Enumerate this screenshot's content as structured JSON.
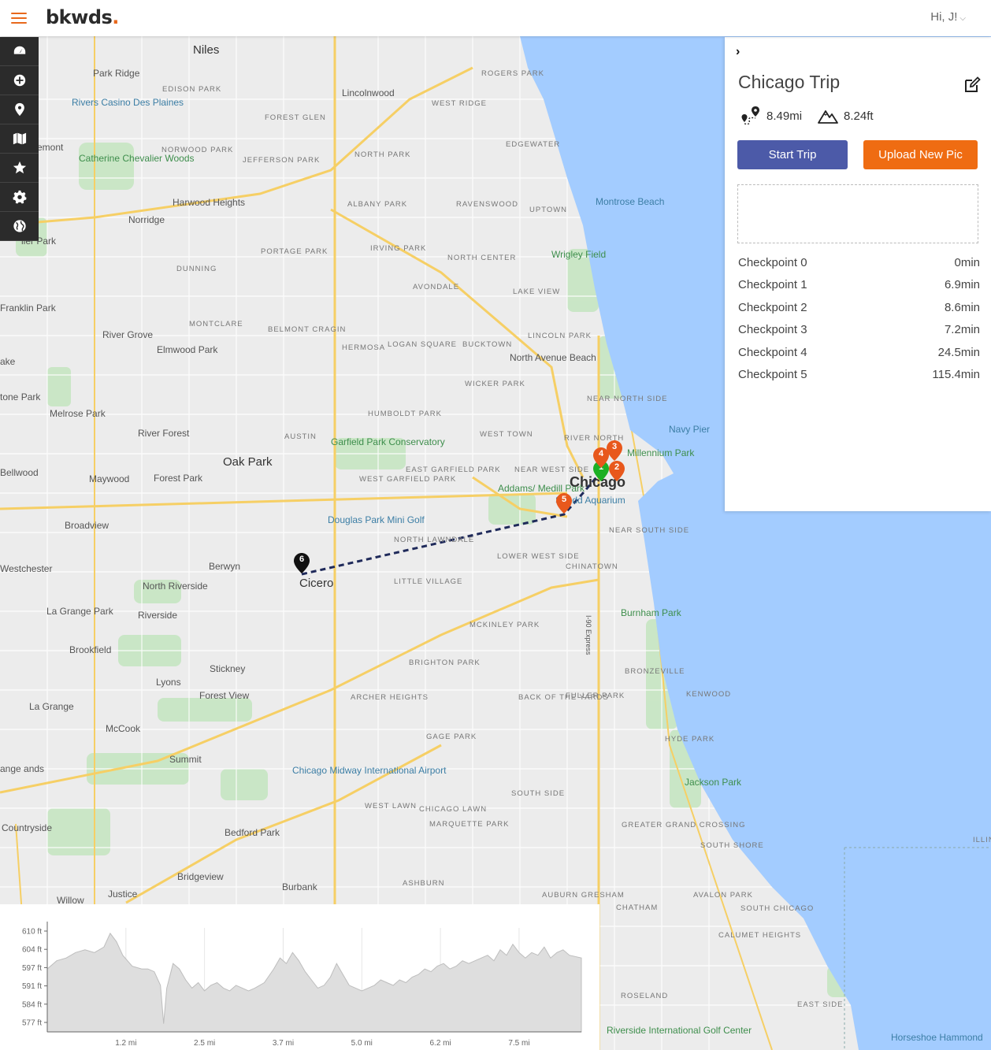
{
  "header": {
    "logo_text": "bkwds",
    "logo_dot": ".",
    "user_greeting": "Hi, J!",
    "user_chevron": "⌵"
  },
  "rail": {
    "items": [
      "dashboard-icon",
      "plus-circle-icon",
      "map-pin-icon",
      "map-icon",
      "star-icon",
      "cog-icon",
      "globe-icon"
    ]
  },
  "colors": {
    "accent": "#ef6c12",
    "primary_button": "#4c5aa8",
    "rail_bg": "#2b2b2b",
    "water": "#a3ccff",
    "start_marker": "#1db024",
    "checkpoint_marker": "#e8581c",
    "end_marker": "#111111",
    "route_line": "#1f2a5a"
  },
  "panel": {
    "collapse_glyph": "›",
    "title": "Chicago Trip",
    "distance": "8.49mi",
    "elevation": "8.24ft",
    "start_button": "Start Trip",
    "upload_button": "Upload New Pic",
    "checkpoints": [
      {
        "name": "Checkpoint 0",
        "time": "0min"
      },
      {
        "name": "Checkpoint 1",
        "time": "6.9min"
      },
      {
        "name": "Checkpoint 2",
        "time": "8.6min"
      },
      {
        "name": "Checkpoint 3",
        "time": "7.2min"
      },
      {
        "name": "Checkpoint 4",
        "time": "24.5min"
      },
      {
        "name": "Checkpoint 5",
        "time": "115.4min"
      }
    ]
  },
  "map": {
    "labels": [
      {
        "t": "Niles",
        "c": "big"
      },
      {
        "t": "Park Ridge",
        "c": ""
      },
      {
        "t": "Lincolnwood",
        "c": ""
      },
      {
        "t": "Rivers Casino Des Plaines",
        "c": "poi"
      },
      {
        "t": "EDISON PARK",
        "c": "small"
      },
      {
        "t": "ROGERS PARK",
        "c": "small"
      },
      {
        "t": "WEST RIDGE",
        "c": "small"
      },
      {
        "t": "FOREST GLEN",
        "c": "small"
      },
      {
        "t": "EDGEWATER",
        "c": "small"
      },
      {
        "t": "NORTH PARK",
        "c": "small"
      },
      {
        "t": "NORWOOD PARK",
        "c": "small"
      },
      {
        "t": "JEFFERSON PARK",
        "c": "small"
      },
      {
        "t": "Catherine Chevalier Woods",
        "c": "park"
      },
      {
        "t": "ALBANY PARK",
        "c": "small"
      },
      {
        "t": "RAVENSWOOD",
        "c": "small"
      },
      {
        "t": "UPTOWN",
        "c": "small"
      },
      {
        "t": "Montrose Beach",
        "c": "poi"
      },
      {
        "t": "Harwood Heights",
        "c": ""
      },
      {
        "t": "Norridge",
        "c": ""
      },
      {
        "t": "PORTAGE PARK",
        "c": "small"
      },
      {
        "t": "IRVING PARK",
        "c": "small"
      },
      {
        "t": "NORTH CENTER",
        "c": "small"
      },
      {
        "t": "Wrigley Field",
        "c": "park"
      },
      {
        "t": "DUNNING",
        "c": "small"
      },
      {
        "t": "AVONDALE",
        "c": "small"
      },
      {
        "t": "LAKE VIEW",
        "c": "small"
      },
      {
        "t": "Franklin Park",
        "c": ""
      },
      {
        "t": "MONTCLARE",
        "c": "small"
      },
      {
        "t": "BELMONT CRAGIN",
        "c": "small"
      },
      {
        "t": "River Grove",
        "c": ""
      },
      {
        "t": "Elmwood Park",
        "c": ""
      },
      {
        "t": "HERMOSA",
        "c": "small"
      },
      {
        "t": "LOGAN SQUARE",
        "c": "small"
      },
      {
        "t": "BUCKTOWN",
        "c": "small"
      },
      {
        "t": "LINCOLN PARK",
        "c": "small"
      },
      {
        "t": "North Avenue Beach",
        "c": ""
      },
      {
        "t": "WICKER PARK",
        "c": "small"
      },
      {
        "t": "NEAR NORTH SIDE",
        "c": "small"
      },
      {
        "t": "Melrose Park",
        "c": ""
      },
      {
        "t": "HUMBOLDT PARK",
        "c": "small"
      },
      {
        "t": "Navy Pier",
        "c": "poi"
      },
      {
        "t": "AUSTIN",
        "c": "small"
      },
      {
        "t": "Garfield Park Conservatory",
        "c": "park"
      },
      {
        "t": "WEST TOWN",
        "c": "small"
      },
      {
        "t": "RIVER NORTH",
        "c": "small"
      },
      {
        "t": "Millennium Park",
        "c": "park"
      },
      {
        "t": "River Forest",
        "c": ""
      },
      {
        "t": "Oak Park",
        "c": "big"
      },
      {
        "t": "Bellwood",
        "c": ""
      },
      {
        "t": "Maywood",
        "c": ""
      },
      {
        "t": "Forest Park",
        "c": ""
      },
      {
        "t": "EAST GARFIELD PARK",
        "c": "small"
      },
      {
        "t": "NEAR WEST SIDE",
        "c": "small"
      },
      {
        "t": "Chicago",
        "c": "city"
      },
      {
        "t": "WEST GARFIELD PARK",
        "c": "small"
      },
      {
        "t": "Addams/ Medill Park",
        "c": "park"
      },
      {
        "t": "Shedd Aquarium",
        "c": "poi"
      },
      {
        "t": "Broadview",
        "c": ""
      },
      {
        "t": "Douglas Park Mini Golf",
        "c": "poi"
      },
      {
        "t": "NORTH LAWNDALE",
        "c": "small"
      },
      {
        "t": "NEAR SOUTH SIDE",
        "c": "small"
      },
      {
        "t": "Westchester",
        "c": ""
      },
      {
        "t": "Berwyn",
        "c": ""
      },
      {
        "t": "Cicero",
        "c": "big"
      },
      {
        "t": "LOWER WEST SIDE",
        "c": "small"
      },
      {
        "t": "CHINATOWN",
        "c": "small"
      },
      {
        "t": "LITTLE VILLAGE",
        "c": "small"
      },
      {
        "t": "North Riverside",
        "c": ""
      },
      {
        "t": "Riverside",
        "c": ""
      },
      {
        "t": "La Grange Park",
        "c": ""
      },
      {
        "t": "Burnham Park",
        "c": "park"
      },
      {
        "t": "MCKINLEY PARK",
        "c": "small"
      },
      {
        "t": "Brookfield",
        "c": ""
      },
      {
        "t": "BRIGHTON PARK",
        "c": "small"
      },
      {
        "t": "BRONZEVILLE",
        "c": "small"
      },
      {
        "t": "Stickney",
        "c": ""
      },
      {
        "t": "Lyons",
        "c": ""
      },
      {
        "t": "Forest View",
        "c": ""
      },
      {
        "t": "ARCHER HEIGHTS",
        "c": "small"
      },
      {
        "t": "BACK OF THE YARDS",
        "c": "small"
      },
      {
        "t": "FULLER PARK",
        "c": "small"
      },
      {
        "t": "KENWOOD",
        "c": "small"
      },
      {
        "t": "La Grange",
        "c": ""
      },
      {
        "t": "McCook",
        "c": ""
      },
      {
        "t": "GAGE PARK",
        "c": "small"
      },
      {
        "t": "HYDE PARK",
        "c": "small"
      },
      {
        "t": "Summit",
        "c": ""
      },
      {
        "t": "Chicago Midway International Airport",
        "c": "poi"
      },
      {
        "t": "Jackson Park",
        "c": "park"
      },
      {
        "t": "SOUTH SIDE",
        "c": "small"
      },
      {
        "t": "WEST LAWN",
        "c": "small"
      },
      {
        "t": "CHICAGO LAWN",
        "c": "small"
      },
      {
        "t": "MARQUETTE PARK",
        "c": "small"
      },
      {
        "t": "GREATER GRAND CROSSING",
        "c": "small"
      },
      {
        "t": "Countryside",
        "c": ""
      },
      {
        "t": "Bedford Park",
        "c": ""
      },
      {
        "t": "SOUTH SHORE",
        "c": "small"
      },
      {
        "t": "Bridgeview",
        "c": ""
      },
      {
        "t": "Burbank",
        "c": ""
      },
      {
        "t": "ASHBURN",
        "c": "small"
      },
      {
        "t": "AVALON PARK",
        "c": "small"
      },
      {
        "t": "Justice",
        "c": ""
      },
      {
        "t": "Willow",
        "c": ""
      },
      {
        "t": "AUBURN GRESHAM",
        "c": "small"
      },
      {
        "t": "CHATHAM",
        "c": "small"
      },
      {
        "t": "SOUTH CHICAGO",
        "c": "small"
      },
      {
        "t": "CALUMET HEIGHTS",
        "c": "small"
      },
      {
        "t": "ROSELAND",
        "c": "small"
      },
      {
        "t": "EAST SIDE",
        "c": "small"
      },
      {
        "t": "Horseshoe Hammond",
        "c": "poi"
      },
      {
        "t": "Riverside International Golf Center",
        "c": "park"
      },
      {
        "t": "I-90 Express",
        "c": ""
      },
      {
        "t": "ILLIN INDI",
        "c": "small"
      },
      {
        "t": "emont",
        "c": ""
      },
      {
        "t": "ller Park",
        "c": ""
      },
      {
        "t": "ake",
        "c": ""
      },
      {
        "t": "tone Park",
        "c": ""
      },
      {
        "t": "ange ands",
        "c": ""
      }
    ],
    "route": {
      "markers": [
        {
          "label": "1",
          "kind": "start"
        },
        {
          "label": "2",
          "kind": "checkpoint"
        },
        {
          "label": "3",
          "kind": "checkpoint"
        },
        {
          "label": "4",
          "kind": "checkpoint"
        },
        {
          "label": "5",
          "kind": "checkpoint"
        },
        {
          "label": "6",
          "kind": "end"
        }
      ]
    }
  },
  "chart_data": {
    "type": "area",
    "title": "",
    "xlabel": "",
    "ylabel": "",
    "y_ticks": [
      "610 ft",
      "604 ft",
      "597 ft",
      "591 ft",
      "584 ft",
      "577 ft"
    ],
    "x_ticks": [
      "1.2 mi",
      "2.5 mi",
      "3.7 mi",
      "5.0 mi",
      "6.2 mi",
      "7.5 mi"
    ],
    "ylim": [
      574,
      612
    ],
    "xlim": [
      0,
      8.49
    ],
    "x": [
      0,
      0.15,
      0.3,
      0.45,
      0.6,
      0.75,
      0.9,
      1.0,
      1.1,
      1.2,
      1.35,
      1.5,
      1.6,
      1.7,
      1.8,
      1.85,
      1.9,
      2.0,
      2.1,
      2.2,
      2.3,
      2.4,
      2.5,
      2.6,
      2.7,
      2.8,
      2.9,
      3.0,
      3.1,
      3.2,
      3.3,
      3.45,
      3.6,
      3.7,
      3.8,
      3.9,
      4.0,
      4.1,
      4.2,
      4.3,
      4.4,
      4.5,
      4.6,
      4.7,
      4.8,
      4.9,
      5.0,
      5.1,
      5.2,
      5.3,
      5.4,
      5.5,
      5.6,
      5.7,
      5.8,
      5.9,
      6.0,
      6.1,
      6.2,
      6.3,
      6.4,
      6.5,
      6.6,
      6.7,
      6.8,
      6.9,
      7.0,
      7.1,
      7.2,
      7.3,
      7.4,
      7.5,
      7.6,
      7.7,
      7.8,
      7.9,
      8.0,
      8.1,
      8.2,
      8.3,
      8.49
    ],
    "values": [
      597,
      600,
      601,
      603,
      604,
      603,
      605,
      610,
      607,
      602,
      598,
      597,
      597,
      596,
      591,
      577,
      590,
      599,
      597,
      593,
      590,
      592,
      589,
      591,
      592,
      590,
      589,
      591,
      590,
      589,
      590,
      592,
      597,
      601,
      599,
      603,
      600,
      596,
      593,
      590,
      591,
      594,
      599,
      595,
      591,
      590,
      589,
      590,
      591,
      593,
      592,
      591,
      593,
      592,
      594,
      595,
      597,
      596,
      598,
      599,
      597,
      598,
      600,
      599,
      600,
      601,
      602,
      600,
      604,
      602,
      606,
      603,
      601,
      603,
      602,
      605,
      601,
      603,
      604,
      602,
      601
    ]
  }
}
